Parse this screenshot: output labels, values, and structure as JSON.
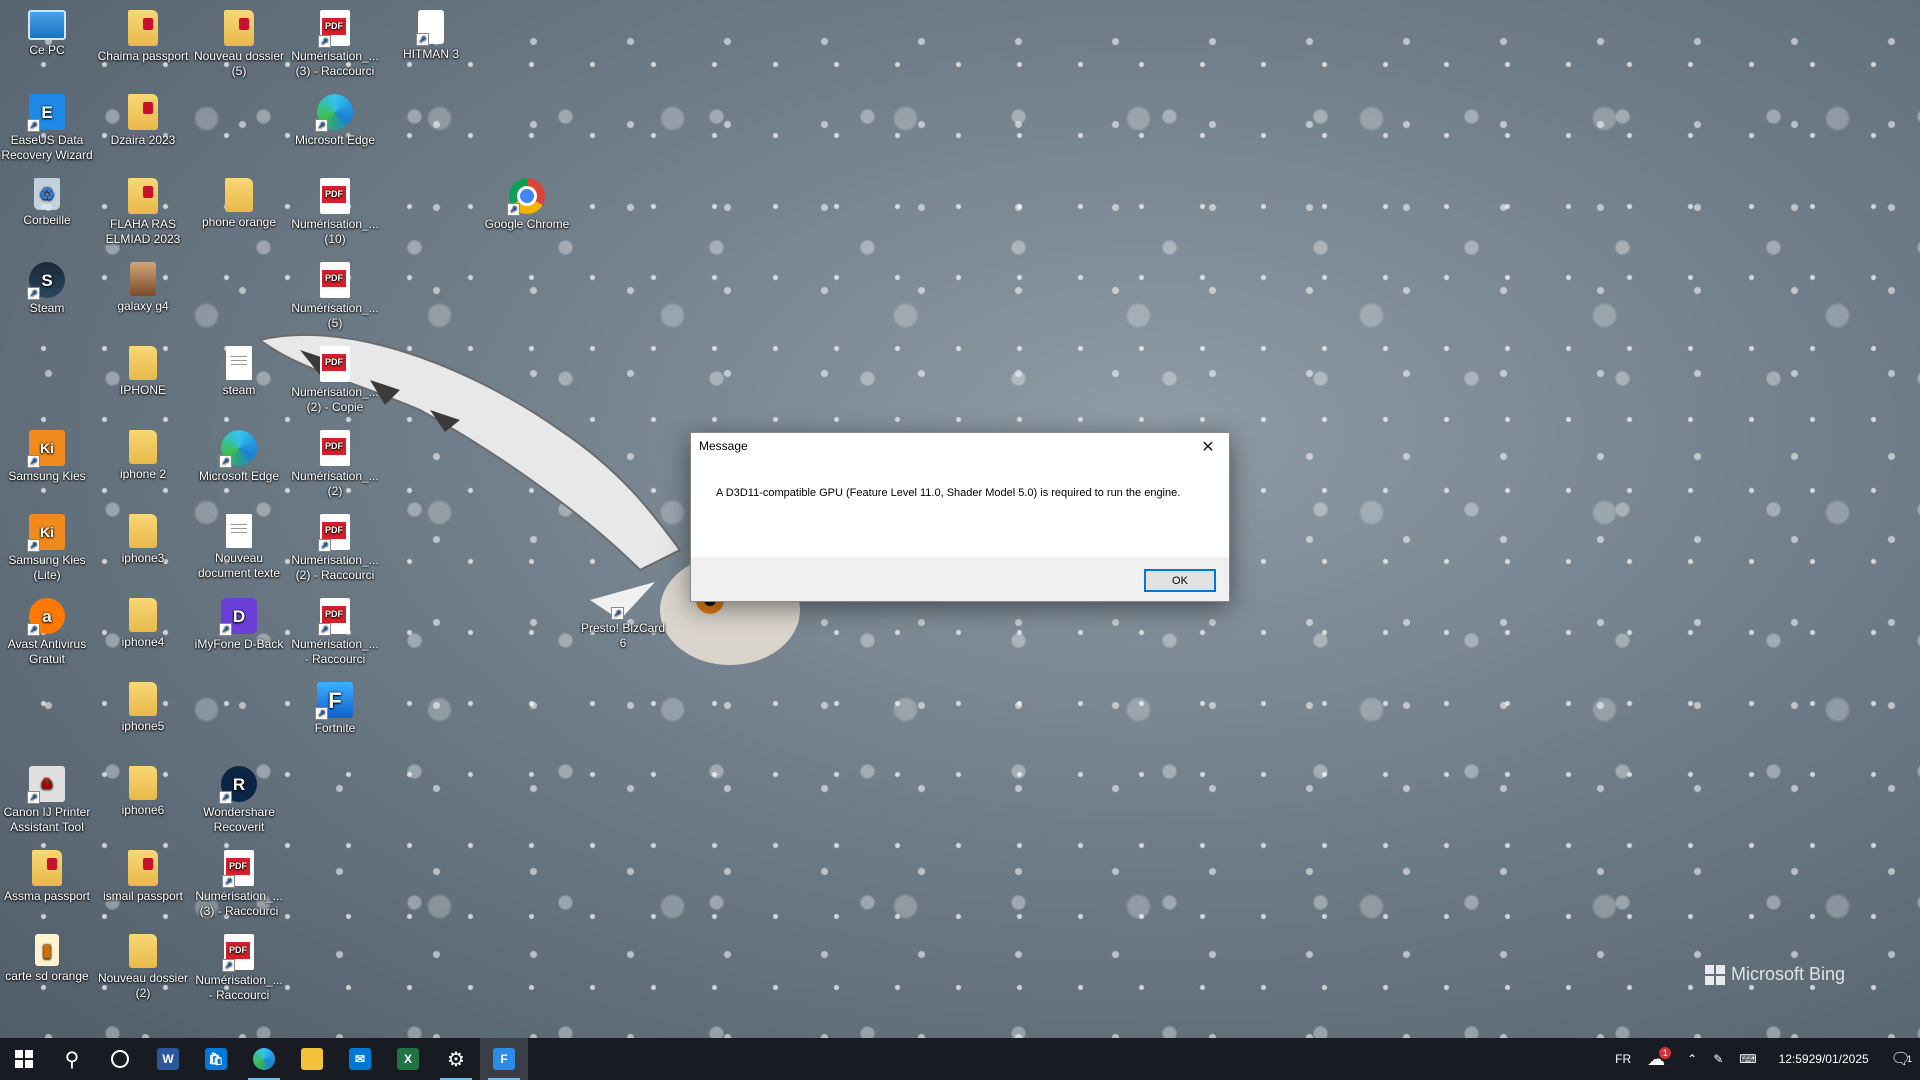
{
  "desktop": {
    "icons": [
      {
        "label": "Ce PC"
      },
      {
        "label": "EaseUS Data Recovery Wizard"
      },
      {
        "label": "Corbeille"
      },
      {
        "label": "Steam"
      },
      {
        "label": "Samsung Kies"
      },
      {
        "label": "Samsung Kies (Lite)"
      },
      {
        "label": "Avast Antivirus Gratuit"
      },
      {
        "label": "Canon IJ Printer Assistant Tool"
      },
      {
        "label": "Assma passport"
      },
      {
        "label": "carte sd orange"
      },
      {
        "label": "Chaima passport"
      },
      {
        "label": "Dzaira 2023"
      },
      {
        "label": "FLAHA RAS ELMIAD 2023"
      },
      {
        "label": "galaxy g4"
      },
      {
        "label": "IPHONE"
      },
      {
        "label": "iphone 2"
      },
      {
        "label": "iphone3"
      },
      {
        "label": "iphone4"
      },
      {
        "label": "iphone5"
      },
      {
        "label": "iphone6"
      },
      {
        "label": "ismail passport"
      },
      {
        "label": "Nouveau dossier (2)"
      },
      {
        "label": "Nouveau dossier (5)"
      },
      {
        "label": "phone orange"
      },
      {
        "label": "steam"
      },
      {
        "label": "Microsoft Edge"
      },
      {
        "label": "Nouveau document texte"
      },
      {
        "label": "iMyFone D-Back"
      },
      {
        "label": "Wondershare Recoverit"
      },
      {
        "label": "Numérisation_... (3) - Raccourci"
      },
      {
        "label": "Numérisation_... - Raccourci"
      },
      {
        "label": "Numérisation_... (3) - Raccourci"
      },
      {
        "label": "Microsoft Edge"
      },
      {
        "label": "Numérisation_... (10)"
      },
      {
        "label": "Numérisation_... (5)"
      },
      {
        "label": "Numérisation_... (2) - Copie"
      },
      {
        "label": "Numérisation_... (2)"
      },
      {
        "label": "Numérisation_... (2) - Raccourci"
      },
      {
        "label": "Numérisation_... - Raccourci"
      },
      {
        "label": "Fortnite"
      },
      {
        "label": "HITMAN 3"
      },
      {
        "label": "Google Chrome"
      },
      {
        "label": "Presto! BizCard 6"
      }
    ],
    "watermark": "Microsoft Bing"
  },
  "dialog": {
    "title": "Message",
    "close_icon": "close-icon",
    "message": "A D3D11-compatible GPU (Feature Level 11.0, Shader Model 5.0) is required to run the engine.",
    "ok_label": "OK"
  },
  "taskbar": {
    "apps": [
      {
        "icon": "windows-start-icon"
      },
      {
        "icon": "search-icon"
      },
      {
        "icon": "cortana-icon"
      },
      {
        "icon": "word-icon",
        "letter": "W",
        "color": "#2b579a"
      },
      {
        "icon": "store-icon",
        "color": "#0078d7"
      },
      {
        "icon": "edge-icon"
      },
      {
        "icon": "file-explorer-icon",
        "color": "#f3c13a"
      },
      {
        "icon": "mail-icon",
        "color": "#0078d7"
      },
      {
        "icon": "excel-icon",
        "letter": "X",
        "color": "#217346"
      },
      {
        "icon": "settings-icon"
      },
      {
        "icon": "fortnite-icon",
        "letter": "F",
        "color": "#2b8be6"
      }
    ],
    "tray": {
      "language": "FR",
      "weather_badge": "1",
      "time": "12:59",
      "date": "29/01/2025",
      "notification_count": "1"
    }
  }
}
